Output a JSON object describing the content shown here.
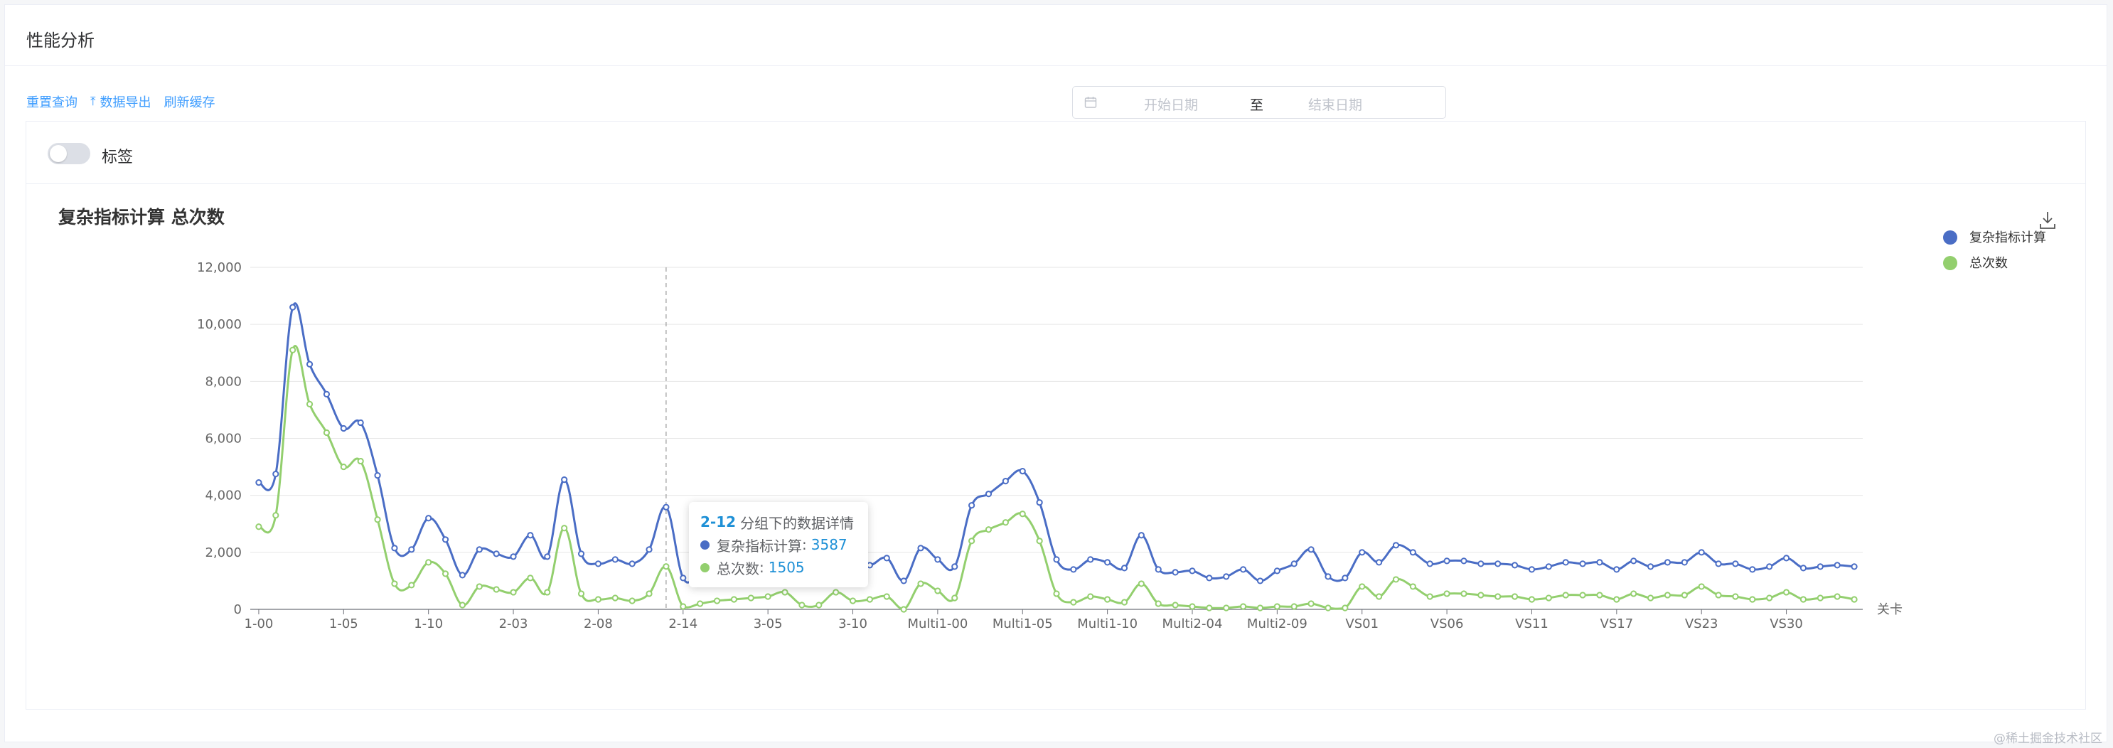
{
  "page": {
    "title": "性能分析"
  },
  "toolbar": {
    "reset": "重置查询",
    "export": "数据导出",
    "refresh": "刷新缓存"
  },
  "date_range": {
    "start_placeholder": "开始日期",
    "separator": "至",
    "end_placeholder": "结束日期"
  },
  "label_toggle": {
    "label": "标签",
    "on": false
  },
  "watermark": "@稀土掘金技术社区",
  "tooltip": {
    "category": "2-12",
    "suffix": "分组下的数据详情",
    "rows": [
      {
        "name": "复杂指标计算",
        "value": "3587"
      },
      {
        "name": "总次数",
        "value": "1505"
      }
    ]
  },
  "colors": {
    "series1": "#4a6dc5",
    "series2": "#93cf6e",
    "accent": "#409eff"
  },
  "chart_data": {
    "type": "line",
    "title": "复杂指标计算 总次数",
    "xlabel": "关卡",
    "ylabel": "",
    "ylim": [
      0,
      12000
    ],
    "yticks": [
      0,
      2000,
      4000,
      6000,
      8000,
      10000,
      12000
    ],
    "ytick_labels": [
      "0",
      "2,000",
      "4,000",
      "6,000",
      "8,000",
      "10,000",
      "12,000"
    ],
    "xtick_labels": [
      "1-00",
      "1-05",
      "1-10",
      "2-03",
      "2-08",
      "2-14",
      "3-05",
      "3-10",
      "Multi1-00",
      "Multi1-05",
      "Multi1-10",
      "Multi2-04",
      "Multi2-09",
      "VS01",
      "VS06",
      "VS11",
      "VS17",
      "VS23",
      "VS30"
    ],
    "xtick_every": 5,
    "highlight_index": 25,
    "legend_position": "top-right",
    "grid": true,
    "smooth": true,
    "series": [
      {
        "name": "复杂指标计算",
        "color": "#4a6dc5",
        "values": [
          4450,
          4750,
          10600,
          8600,
          7550,
          6350,
          6550,
          4700,
          2150,
          2100,
          3200,
          2450,
          1200,
          2100,
          1950,
          1850,
          2600,
          1850,
          4550,
          1950,
          1600,
          1750,
          1600,
          2100,
          3587,
          1100,
          1250,
          1200,
          1700,
          1800,
          1550,
          1850,
          1750,
          1300,
          1550,
          1750,
          1550,
          1800,
          1000,
          2150,
          1750,
          1500,
          3650,
          4050,
          4500,
          4850,
          3750,
          1750,
          1400,
          1750,
          1650,
          1450,
          2600,
          1400,
          1300,
          1350,
          1100,
          1150,
          1400,
          1000,
          1350,
          1600,
          2100,
          1150,
          1100,
          2000,
          1650,
          2250,
          2000,
          1600,
          1700,
          1700,
          1600,
          1600,
          1550,
          1400,
          1500,
          1650,
          1600,
          1650,
          1400,
          1700,
          1500,
          1650,
          1650,
          2000,
          1600,
          1600,
          1400,
          1500,
          1800,
          1450,
          1500,
          1550,
          1500
        ]
      },
      {
        "name": "总次数",
        "color": "#93cf6e",
        "values": [
          2900,
          3300,
          9100,
          7200,
          6200,
          5000,
          5200,
          3150,
          900,
          850,
          1650,
          1250,
          150,
          800,
          700,
          600,
          1100,
          600,
          2850,
          550,
          350,
          400,
          300,
          550,
          1505,
          100,
          200,
          300,
          350,
          400,
          450,
          600,
          150,
          150,
          600,
          300,
          350,
          450,
          0,
          900,
          650,
          400,
          2400,
          2800,
          3050,
          3350,
          2400,
          550,
          250,
          450,
          350,
          250,
          900,
          200,
          150,
          100,
          50,
          50,
          100,
          50,
          100,
          100,
          200,
          50,
          50,
          800,
          450,
          1050,
          800,
          450,
          550,
          550,
          500,
          450,
          450,
          350,
          400,
          500,
          500,
          500,
          350,
          550,
          400,
          500,
          500,
          800,
          500,
          450,
          350,
          400,
          600,
          350,
          400,
          450,
          350
        ]
      }
    ]
  }
}
